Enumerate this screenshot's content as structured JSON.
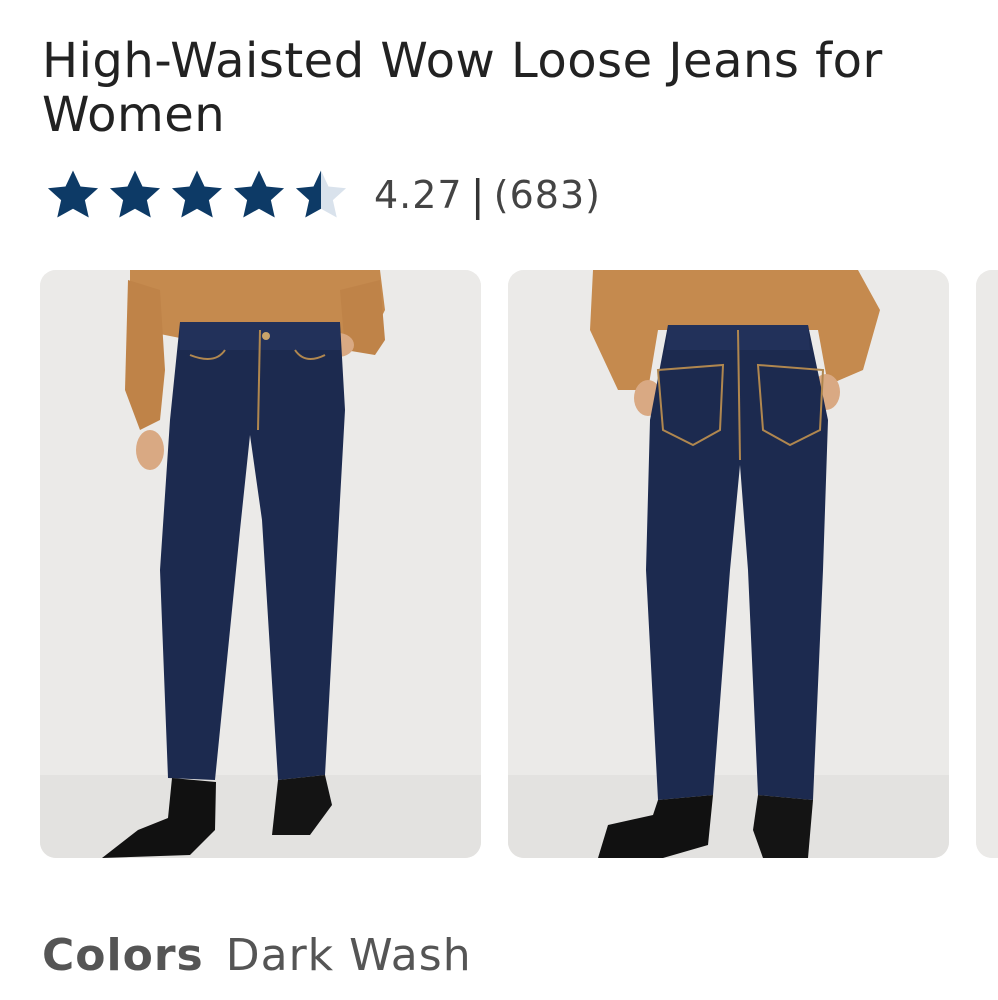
{
  "product": {
    "title_line1": "High-Waisted Wow Loose Jeans for",
    "title_line2": "Women"
  },
  "rating": {
    "value": "4.27",
    "separator": "|",
    "count": "(683)",
    "stars_filled_fraction": 0.854
  },
  "gallery": {
    "images": [
      {
        "icon": "jeans-front-photo"
      },
      {
        "icon": "jeans-back-photo"
      },
      {
        "icon": "jeans-side-photo"
      }
    ]
  },
  "colors": {
    "label": "Colors",
    "selected": "Dark Wash"
  },
  "palette": {
    "star_fill": "#0d3a66",
    "star_empty": "#d9e2ec",
    "denim": "#1c2a4f",
    "shirt": "#c58a4e",
    "background": "#ebeae8"
  }
}
